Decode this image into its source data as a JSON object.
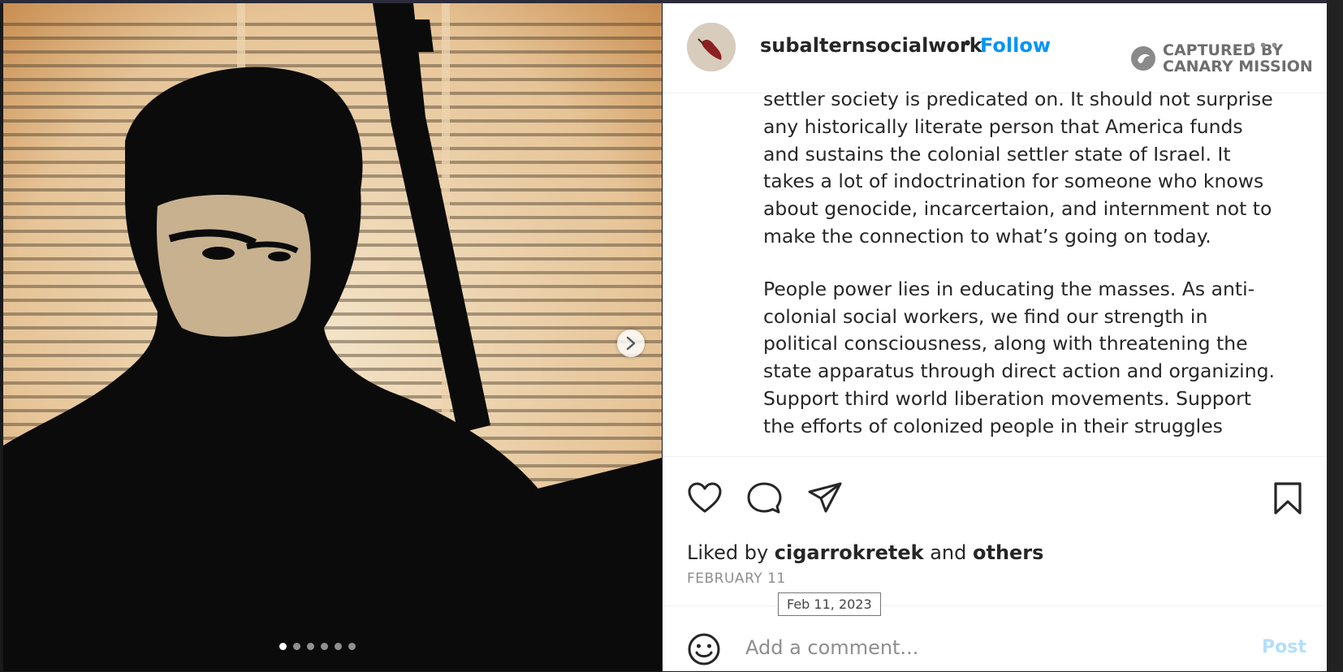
{
  "post": {
    "username": "subalternsocialwork",
    "separator": "•",
    "follow_label": "Follow",
    "more_icon": "more-horizontal-icon",
    "captured_line1": "CAPTURED BY",
    "captured_line2": "CANARY MISSION",
    "caption_paragraphs": [
      "settler society is predicated on. It should not surprise any historically literate person that America funds and sustains the colonial settler state of Israel. It takes a lot of indoctrination for someone who knows about genocide, incarcertaion, and internment not to make the connection to what’s going on today.",
      "People power lies in educating the masses. As anti-colonial social workers, we find our strength in political consciousness, along with threatening the state apparatus through direct action and organizing. Support third world liberation movements. Support the efforts of colonized people in their struggles"
    ],
    "liked_prefix": "Liked by ",
    "liked_user": "cigarrokretek",
    "liked_and": " and ",
    "liked_others": "others",
    "date": "FEBRUARY 11",
    "date_tooltip": "Feb 11, 2023",
    "comment_placeholder": "Add a comment...",
    "post_label": "Post",
    "carousel_count": 6,
    "carousel_active": 1
  },
  "icons": {
    "like": "heart-icon",
    "comment": "comment-icon",
    "share": "paper-plane-icon",
    "save": "bookmark-icon",
    "emoji": "emoji-icon",
    "next": "chevron-right-icon"
  },
  "colors": {
    "follow": "#0095f6",
    "post_disabled": "#b2dffc",
    "text": "#262626",
    "muted": "#8e8e8e"
  }
}
